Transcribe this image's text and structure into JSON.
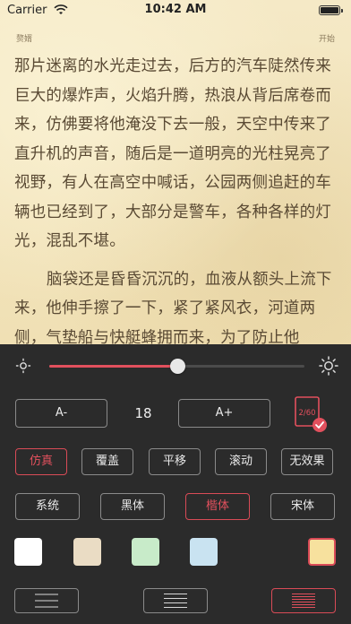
{
  "status_bar": {
    "carrier": "Carrier",
    "time": "10:42 AM"
  },
  "reader": {
    "book_title": "赘婿",
    "chapter_label": "开始",
    "paragraphs": [
      "那片迷离的水光走过去，后方的汽车陡然传来巨大的爆炸声，火焰升腾，热浪从背后席卷而来，仿佛要将他淹没下去一般，天空中传来了直升机的声音，随后是一道明亮的光柱晃亮了视野，有人在高空中喊话，公园两侧追赶的车辆也已经到了，大部分是警车，各种各样的灯光，混乱不堪。",
      "脑袋还是昏昏沉沉的，血液从额头上流下来，他伸手擦了一下，紧了紧风衣，河道两侧，气垫船与快艇蜂拥而来，为了防止他"
    ]
  },
  "settings": {
    "brightness": 0.5,
    "font_size": {
      "decrease_label": "A-",
      "value": "18",
      "increase_label": "A+"
    },
    "page_indicator": "2/60",
    "page_modes": [
      {
        "label": "仿真",
        "selected": true
      },
      {
        "label": "覆盖",
        "selected": false
      },
      {
        "label": "平移",
        "selected": false
      },
      {
        "label": "滚动",
        "selected": false
      },
      {
        "label": "无效果",
        "selected": false
      }
    ],
    "fonts": [
      {
        "label": "系统",
        "selected": false
      },
      {
        "label": "黑体",
        "selected": false
      },
      {
        "label": "楷体",
        "selected": true
      },
      {
        "label": "宋体",
        "selected": false
      }
    ],
    "backgrounds": [
      {
        "color": "#ffffff",
        "selected": false
      },
      {
        "color": "#eadcc4",
        "selected": false
      },
      {
        "color": "#c8ebc9",
        "selected": false
      },
      {
        "color": "#c9e3f1",
        "selected": false
      },
      {
        "color": "#f7e19e",
        "selected": true
      }
    ],
    "line_spacing": [
      {
        "name": "wide",
        "selected": false
      },
      {
        "name": "medium",
        "selected": false
      },
      {
        "name": "narrow",
        "selected": true
      }
    ],
    "accent_color": "#e2505d"
  }
}
